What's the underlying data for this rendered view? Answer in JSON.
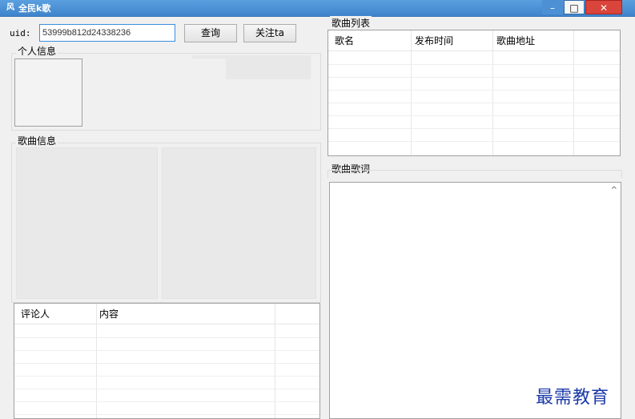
{
  "window": {
    "app_icon": "风",
    "title": "全民k歌",
    "minimize": "–",
    "maximize": "□",
    "close": "✕"
  },
  "search": {
    "uid_label": "uid:",
    "uid_value": "53999b812d24338236",
    "query_button": "查询",
    "follow_button": "关注ta"
  },
  "profile": {
    "group_label": "个人信息"
  },
  "song_info": {
    "group_label": "歌曲信息"
  },
  "comments": {
    "columns": [
      "评论人",
      "内容"
    ]
  },
  "song_list": {
    "group_label": "歌曲列表",
    "columns": [
      "歌名",
      "发布时间",
      "歌曲地址"
    ]
  },
  "lyrics": {
    "group_label": "歌曲歌词",
    "scroll_up": "^"
  },
  "watermark": "最需教育"
}
